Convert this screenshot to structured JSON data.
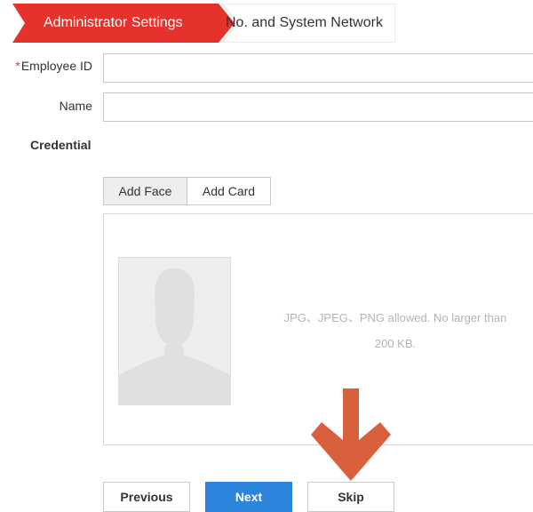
{
  "wizard": {
    "steps": [
      {
        "label": "Administrator Settings",
        "active": true
      },
      {
        "label": "No. and System Network",
        "active": false
      }
    ]
  },
  "form": {
    "employee_id": {
      "label": "Employee ID",
      "required_mark": "*",
      "value": ""
    },
    "name": {
      "label": "Name",
      "value": ""
    },
    "credential_label": "Credential"
  },
  "credential_tabs": [
    {
      "label": "Add Face",
      "active": true
    },
    {
      "label": "Add Card",
      "active": false
    }
  ],
  "upload": {
    "hint_line1": "JPG、JPEG、PNG allowed. No larger than",
    "hint_line2": "200 KB."
  },
  "buttons": {
    "previous": "Previous",
    "next": "Next",
    "skip": "Skip"
  },
  "colors": {
    "accent_red": "#e5322d",
    "primary_blue": "#2d84dc",
    "annotation_arrow": "#d9603d"
  },
  "icons": {
    "face_placeholder": "avatar-silhouette-icon",
    "annotation": "arrow-down-icon"
  }
}
